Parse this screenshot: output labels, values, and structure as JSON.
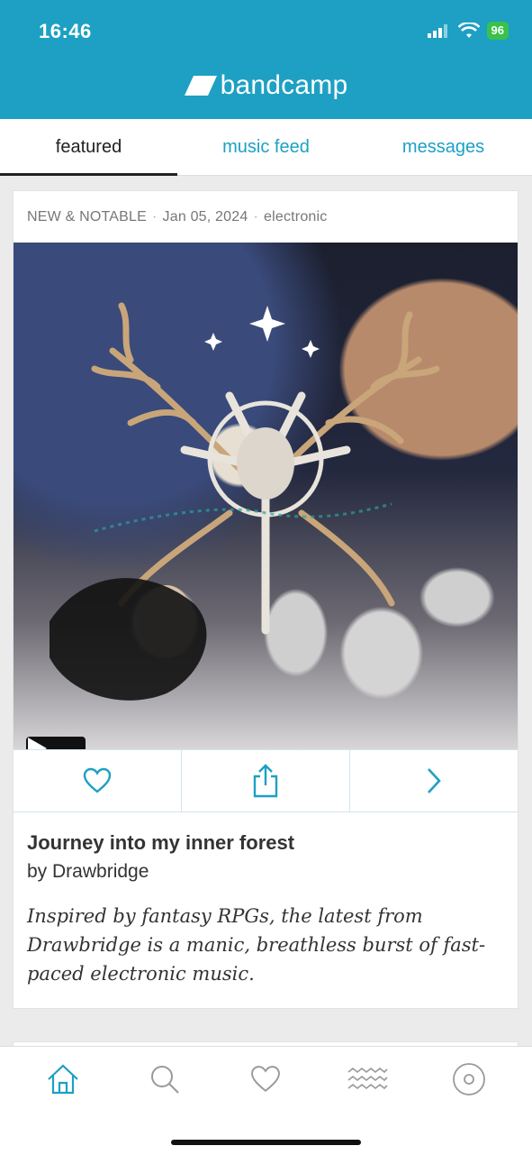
{
  "status_bar": {
    "time": "16:46",
    "battery": "96"
  },
  "app": {
    "name": "bandcamp"
  },
  "tabs": [
    {
      "label": "featured",
      "active": true
    },
    {
      "label": "music feed",
      "active": false
    },
    {
      "label": "messages",
      "active": false
    }
  ],
  "card": {
    "category": "NEW & NOTABLE",
    "date": "Jan 05, 2024",
    "genre": "electronic",
    "title": "Journey into my inner forest",
    "artist": "by Drawbridge",
    "description": "Inspired by fantasy RPGs, the latest from Drawbridge is a manic, breathless burst of fast-paced electronic music."
  },
  "actions": [
    {
      "icon": "heart-icon"
    },
    {
      "icon": "share-icon"
    },
    {
      "icon": "chevron-right-icon"
    }
  ],
  "bottom_nav": [
    {
      "icon": "home-icon",
      "active": true
    },
    {
      "icon": "search-icon",
      "active": false
    },
    {
      "icon": "heart-icon",
      "active": false
    },
    {
      "icon": "waves-icon",
      "active": false
    },
    {
      "icon": "vinyl-icon",
      "active": false
    }
  ],
  "colors": {
    "brand": "#1da0c3",
    "text": "#333333",
    "muted": "#777777"
  }
}
